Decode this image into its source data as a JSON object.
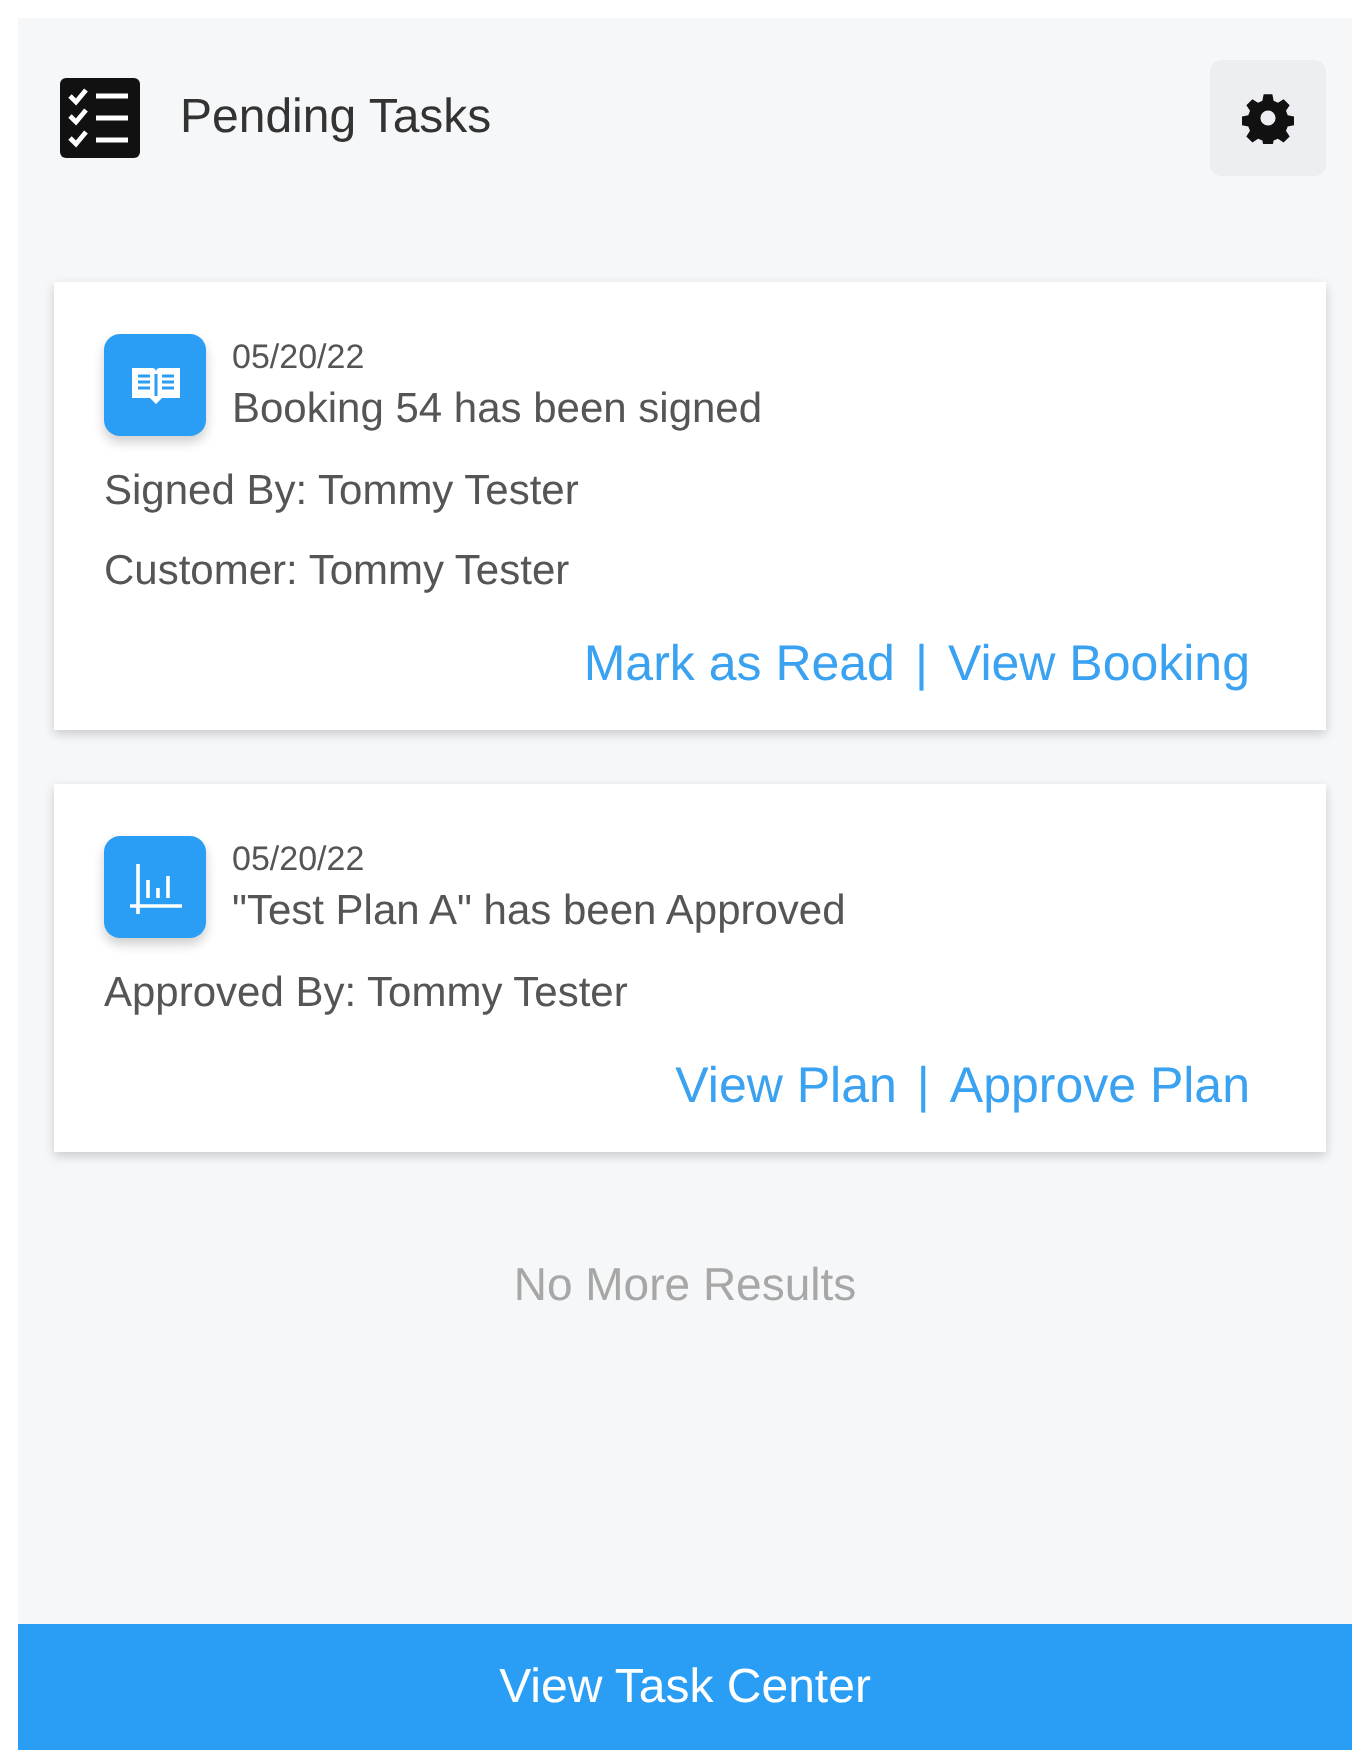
{
  "header": {
    "title": "Pending Tasks"
  },
  "tasks": [
    {
      "kind": "booking",
      "date": "05/20/22",
      "title": "Booking 54 has been signed",
      "details": [
        "Signed By: Tommy Tester",
        "Customer: Tommy Tester"
      ],
      "links": [
        "Mark as Read",
        "View Booking"
      ],
      "separator": "|"
    },
    {
      "kind": "plan",
      "date": "05/20/22",
      "title": "\"Test Plan A\" has been Approved",
      "details": [
        "Approved By: Tommy Tester"
      ],
      "links": [
        "View Plan",
        "Approve Plan"
      ],
      "separator": "|"
    }
  ],
  "end_message": "No More Results",
  "footer_button": "View Task Center"
}
